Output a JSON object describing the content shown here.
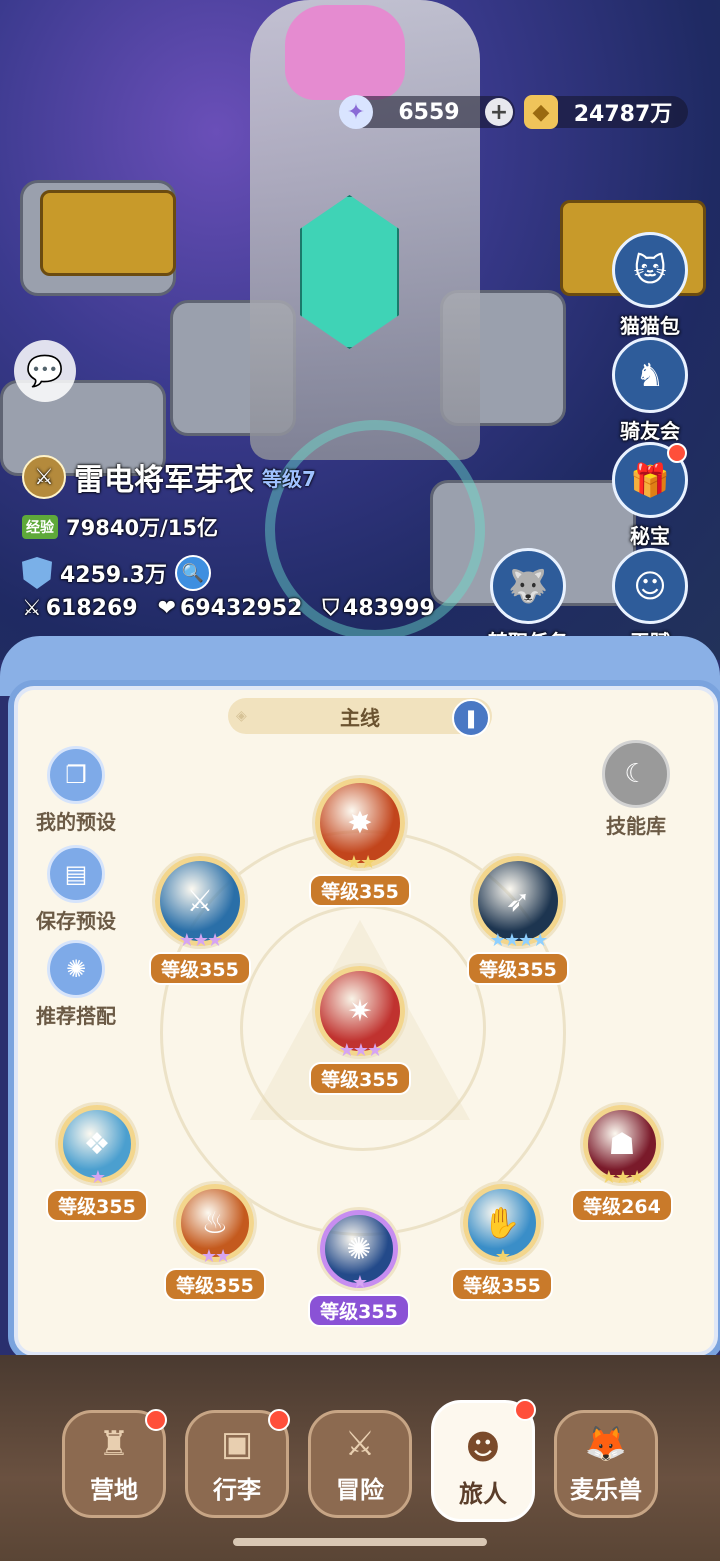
{
  "resources": {
    "stars": "6559",
    "coins": "24787万"
  },
  "side_buttons": [
    {
      "label": "猫猫包",
      "icon": "cat-bag-icon",
      "badge": false
    },
    {
      "label": "骑友会",
      "icon": "horse-icon",
      "badge": false
    },
    {
      "label": "秘宝",
      "icon": "treasure-icon",
      "badge": true
    },
    {
      "label": "转职任务",
      "icon": "class-change-icon",
      "badge": false
    },
    {
      "label": "天赋",
      "icon": "talent-icon",
      "badge": false
    }
  ],
  "player": {
    "name": "雷电将军芽衣",
    "level": "等级7",
    "exp_tag": "经验",
    "exp": "79840万/15亿",
    "power": "4259.3万",
    "attack": "618269",
    "hp": "69432952",
    "defense": "483999"
  },
  "panel": {
    "tab": "主线",
    "left_buttons": [
      "我的预设",
      "保存预设",
      "推荐搭配"
    ],
    "skill_library": "技能库"
  },
  "skills": [
    {
      "level": "等级355",
      "stars": "★★",
      "star_color": "#f2d36b",
      "color": "#c2451c",
      "badge": "orange"
    },
    {
      "level": "等级355",
      "stars": "★★★",
      "star_color": "#d6a5f2",
      "color": "#2a6fa8",
      "badge": "orange"
    },
    {
      "level": "等级355",
      "stars": "★★★★",
      "star_color": "#8fd0ff",
      "color": "#1d3550",
      "badge": "orange"
    },
    {
      "level": "等级355",
      "stars": "★★★",
      "star_color": "#d6a5f2",
      "color": "#c0322f",
      "badge": "orange"
    },
    {
      "level": "等级355",
      "stars": "★",
      "star_color": "#d6a5f2",
      "color": "#4b9fcf",
      "badge": "orange"
    },
    {
      "level": "等级264",
      "stars": "★★★",
      "star_color": "#f2d36b",
      "color": "#7a1a2a",
      "badge": "orange"
    },
    {
      "level": "等级355",
      "stars": "★★",
      "star_color": "#d6a5f2",
      "color": "#c45a1e",
      "badge": "orange"
    },
    {
      "level": "等级355",
      "stars": "★",
      "star_color": "#f2d36b",
      "color": "#3a8ec8",
      "badge": "orange"
    },
    {
      "level": "等级355",
      "stars": "★",
      "star_color": "#d6a5f2",
      "color": "#234a8a",
      "badge": "purple"
    }
  ],
  "nav": [
    {
      "label": "营地",
      "badge": true,
      "active": false
    },
    {
      "label": "行李",
      "badge": true,
      "active": false
    },
    {
      "label": "冒险",
      "badge": false,
      "active": false
    },
    {
      "label": "旅人",
      "badge": true,
      "active": true
    },
    {
      "label": "麦乐兽",
      "badge": false,
      "active": false
    }
  ]
}
